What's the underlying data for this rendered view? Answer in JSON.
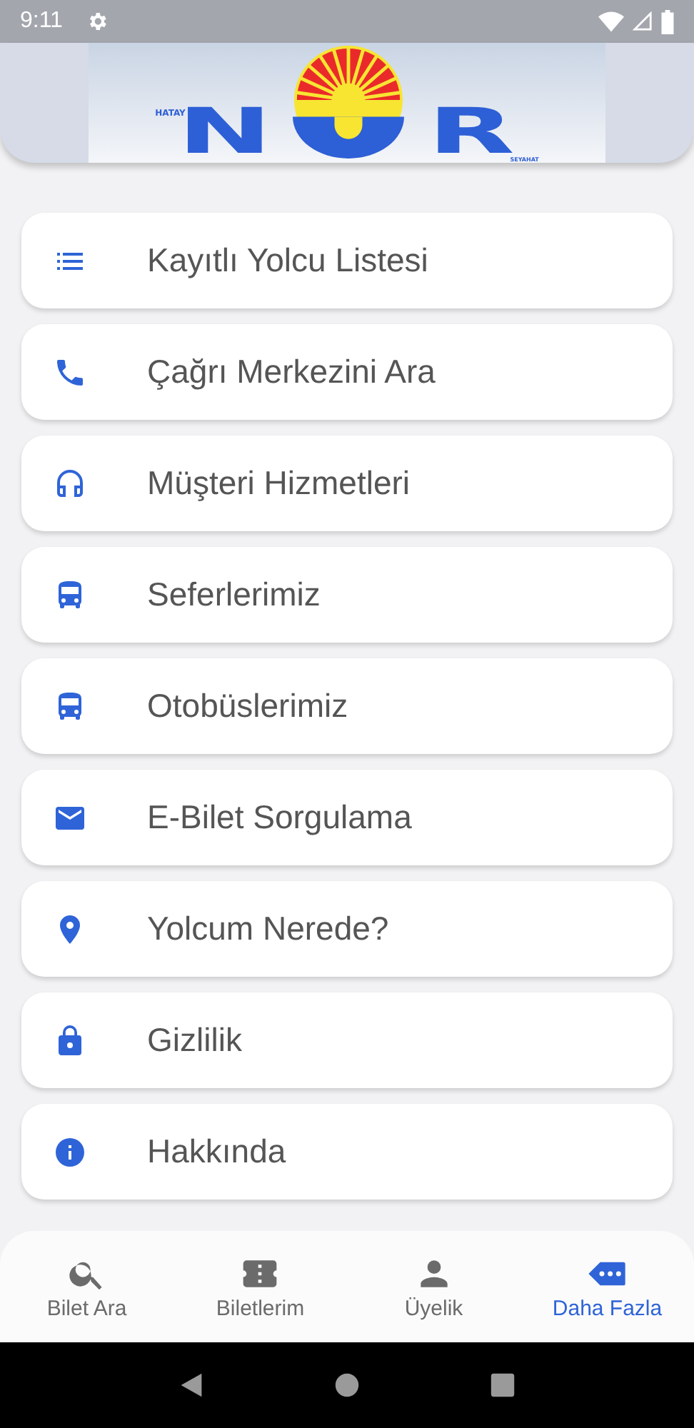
{
  "status_bar": {
    "time": "9:11"
  },
  "logo": {
    "tagline_top": "HATAY",
    "letter_left": "N",
    "letter_right": "R",
    "tagline_bottom": "SEYAHAT"
  },
  "menu": [
    {
      "label": "Kayıtlı Yolcu Listesi",
      "kind": "list"
    },
    {
      "label": "Çağrı Merkezini Ara",
      "kind": "phone"
    },
    {
      "label": "Müşteri Hizmetleri",
      "kind": "headset"
    },
    {
      "label": "Seferlerimiz",
      "kind": "bus"
    },
    {
      "label": "Otobüslerimiz",
      "kind": "bus"
    },
    {
      "label": "E-Bilet Sorgulama",
      "kind": "mail"
    },
    {
      "label": "Yolcum Nerede?",
      "kind": "pin"
    },
    {
      "label": "Gizlilik",
      "kind": "lock"
    },
    {
      "label": "Hakkında",
      "kind": "info"
    }
  ],
  "bottom_nav": [
    {
      "label": "Bilet Ara",
      "kind": "search",
      "selected": false
    },
    {
      "label": "Biletlerim",
      "kind": "ticket",
      "selected": false
    },
    {
      "label": "Üyelik",
      "kind": "person",
      "selected": false
    },
    {
      "label": "Daha Fazla",
      "kind": "more",
      "selected": true
    }
  ]
}
